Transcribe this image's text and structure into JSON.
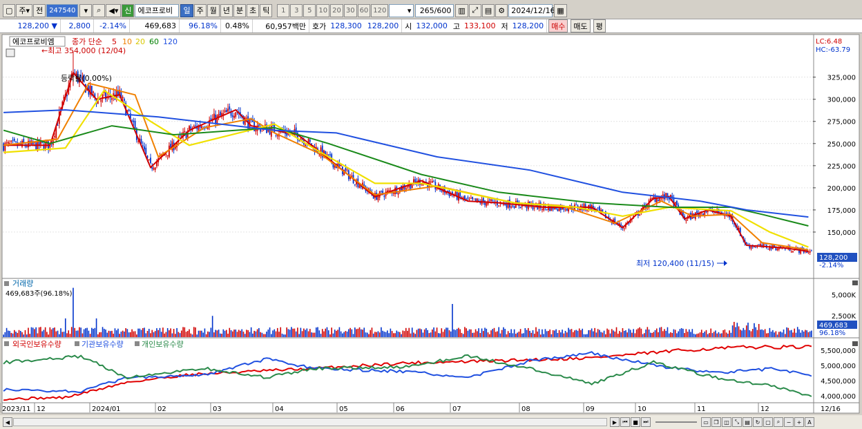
{
  "toolbar": {
    "type_label": "주",
    "market_label": "전",
    "stock_code": "247540",
    "new_label": "신",
    "stock_name": "에코프로비",
    "periods": [
      "일",
      "주",
      "월",
      "년",
      "분",
      "초",
      "틱"
    ],
    "active_period": "일",
    "intervals": [
      "1",
      "3",
      "5",
      "10",
      "20",
      "30",
      "60",
      "120"
    ],
    "count": "265/600",
    "date": "2024/12/16"
  },
  "quote": {
    "price": "128,200",
    "arrow": "▼",
    "change": "2,800",
    "change_pct": "-2.14%",
    "volume": "469,683",
    "vol_ratio": "96.18%",
    "turnover": "0.48%",
    "amount": "60,957백만",
    "ask_label": "호가",
    "ask": "128,300",
    "bid": "128,200",
    "open_label": "시",
    "open": "132,000",
    "high_label": "고",
    "high": "133,100",
    "low_label": "저",
    "low": "128,200",
    "buy": "매수",
    "sell": "매도",
    "eval": "평"
  },
  "price_panel": {
    "name_box": "에코프로비엠",
    "ma_label": "종가 단순",
    "ma_periods": [
      "5",
      "10",
      "20",
      "60",
      "120"
    ],
    "ma_colors": [
      "#d00000",
      "#f08000",
      "#e8e800",
      "#008000",
      "#2050e0"
    ],
    "high_annotation": "←최고 354,000 (12/04)",
    "low_annotation": "최저 120,400 (11/15)",
    "misc_label": "등락률(0.00%)",
    "lc": "LC:6.48",
    "hc": "HC:-63.79",
    "current_price_tag": "128,200",
    "current_pct_tag": "-2.14%",
    "y_ticks": [
      "325,000",
      "300,000",
      "275,000",
      "250,000",
      "225,000",
      "200,000",
      "175,000",
      "150,000"
    ]
  },
  "volume_panel": {
    "title": "거래량",
    "subtitle": "469,683주(96.18%)",
    "y_ticks": [
      "5,000K",
      "2,500K"
    ],
    "tag_value": "469,683",
    "tag_pct": "96.18%"
  },
  "holding_panel": {
    "legend": [
      {
        "name": "외국인보유수량",
        "color": "#d00000"
      },
      {
        "name": "기관보유수량",
        "color": "#2050e0"
      },
      {
        "name": "개인보유수량",
        "color": "#2a8a4a"
      }
    ],
    "y_ticks": [
      "5,500,000",
      "5,000,000",
      "4,500,000",
      "4,000,000"
    ]
  },
  "x_axis": {
    "labels": [
      "2023/11",
      "12",
      "2024/01",
      "02",
      "03",
      "04",
      "05",
      "06",
      "07",
      "08",
      "09",
      "10",
      "11",
      "12",
      "12/16"
    ]
  },
  "chart_data": [
    {
      "type": "candlestick",
      "title": "에코프로비엠",
      "y_range": [
        120000,
        354000
      ],
      "high": {
        "value": 354000,
        "date": "12/04"
      },
      "low": {
        "value": 120400,
        "date": "11/15"
      },
      "last": 128200,
      "ma_points": {
        "5": [
          [
            0,
            248000
          ],
          [
            30,
            248000
          ],
          [
            45,
            330000
          ],
          [
            60,
            300000
          ],
          [
            75,
            305000
          ],
          [
            95,
            223000
          ],
          [
            120,
            265000
          ],
          [
            150,
            288000
          ],
          [
            160,
            270000
          ],
          [
            190,
            260000
          ],
          [
            205,
            240000
          ],
          [
            240,
            190000
          ],
          [
            270,
            208000
          ],
          [
            300,
            185000
          ],
          [
            320,
            183000
          ],
          [
            350,
            178000
          ],
          [
            380,
            178000
          ],
          [
            400,
            155000
          ],
          [
            420,
            188000
          ],
          [
            430,
            190000
          ],
          [
            440,
            165000
          ],
          [
            455,
            175000
          ],
          [
            470,
            168000
          ],
          [
            480,
            135000
          ],
          [
            505,
            132000
          ],
          [
            520,
            128200
          ]
        ],
        "10": [
          [
            0,
            248000
          ],
          [
            35,
            255000
          ],
          [
            55,
            318000
          ],
          [
            85,
            305000
          ],
          [
            100,
            235000
          ],
          [
            130,
            268000
          ],
          [
            160,
            278000
          ],
          [
            175,
            262000
          ],
          [
            205,
            238000
          ],
          [
            240,
            192000
          ],
          [
            280,
            202000
          ],
          [
            330,
            183000
          ],
          [
            360,
            180000
          ],
          [
            395,
            160000
          ],
          [
            425,
            185000
          ],
          [
            445,
            168000
          ],
          [
            470,
            170000
          ],
          [
            490,
            138000
          ],
          [
            520,
            130000
          ]
        ],
        "20": [
          [
            0,
            240000
          ],
          [
            40,
            245000
          ],
          [
            65,
            310000
          ],
          [
            95,
            275000
          ],
          [
            120,
            248000
          ],
          [
            175,
            272000
          ],
          [
            200,
            245000
          ],
          [
            240,
            205000
          ],
          [
            270,
            205000
          ],
          [
            330,
            183000
          ],
          [
            370,
            178000
          ],
          [
            400,
            168000
          ],
          [
            430,
            178000
          ],
          [
            470,
            174000
          ],
          [
            495,
            150000
          ],
          [
            520,
            133000
          ]
        ],
        "60": [
          [
            0,
            265000
          ],
          [
            30,
            250000
          ],
          [
            70,
            270000
          ],
          [
            110,
            260000
          ],
          [
            175,
            268000
          ],
          [
            210,
            250000
          ],
          [
            270,
            215000
          ],
          [
            320,
            195000
          ],
          [
            380,
            183000
          ],
          [
            430,
            178000
          ],
          [
            470,
            178000
          ],
          [
            490,
            170000
          ],
          [
            520,
            157000
          ]
        ],
        "120": [
          [
            0,
            285000
          ],
          [
            40,
            288000
          ],
          [
            100,
            280000
          ],
          [
            175,
            265000
          ],
          [
            215,
            262000
          ],
          [
            280,
            235000
          ],
          [
            340,
            220000
          ],
          [
            400,
            195000
          ],
          [
            450,
            185000
          ],
          [
            480,
            175000
          ],
          [
            520,
            167000
          ]
        ]
      }
    },
    {
      "type": "bar",
      "title": "거래량",
      "y_range": [
        0,
        6500000
      ],
      "last": 469683
    },
    {
      "type": "line",
      "title": "보유수량",
      "y_range": [
        3800000,
        5700000
      ],
      "series": [
        {
          "name": "외국인보유수량",
          "points": [
            [
              0,
              3900000
            ],
            [
              40,
              3950000
            ],
            [
              80,
              4450000
            ],
            [
              120,
              4700000
            ],
            [
              200,
              4900000
            ],
            [
              260,
              5080000
            ],
            [
              320,
              5150000
            ],
            [
              380,
              5250000
            ],
            [
              440,
              5500000
            ],
            [
              480,
              5600000
            ],
            [
              520,
              5600000
            ]
          ]
        },
        {
          "name": "기관보유수량",
          "points": [
            [
              0,
              4200000
            ],
            [
              50,
              4150000
            ],
            [
              80,
              4600000
            ],
            [
              130,
              4700000
            ],
            [
              170,
              5200000
            ],
            [
              200,
              4900000
            ],
            [
              260,
              4800000
            ],
            [
              300,
              4600000
            ],
            [
              340,
              5150000
            ],
            [
              380,
              5400000
            ],
            [
              420,
              5000000
            ],
            [
              460,
              4750000
            ],
            [
              500,
              4900000
            ],
            [
              520,
              4650000
            ]
          ]
        },
        {
          "name": "개인보유수량",
          "points": [
            [
              0,
              5100000
            ],
            [
              50,
              5300000
            ],
            [
              80,
              4600000
            ],
            [
              130,
              4900000
            ],
            [
              170,
              4600000
            ],
            [
              200,
              4900000
            ],
            [
              260,
              4950000
            ],
            [
              300,
              5300000
            ],
            [
              340,
              4900000
            ],
            [
              380,
              4400000
            ],
            [
              420,
              5100000
            ],
            [
              460,
              4600000
            ],
            [
              500,
              4300000
            ],
            [
              520,
              4000000
            ]
          ]
        }
      ]
    }
  ]
}
